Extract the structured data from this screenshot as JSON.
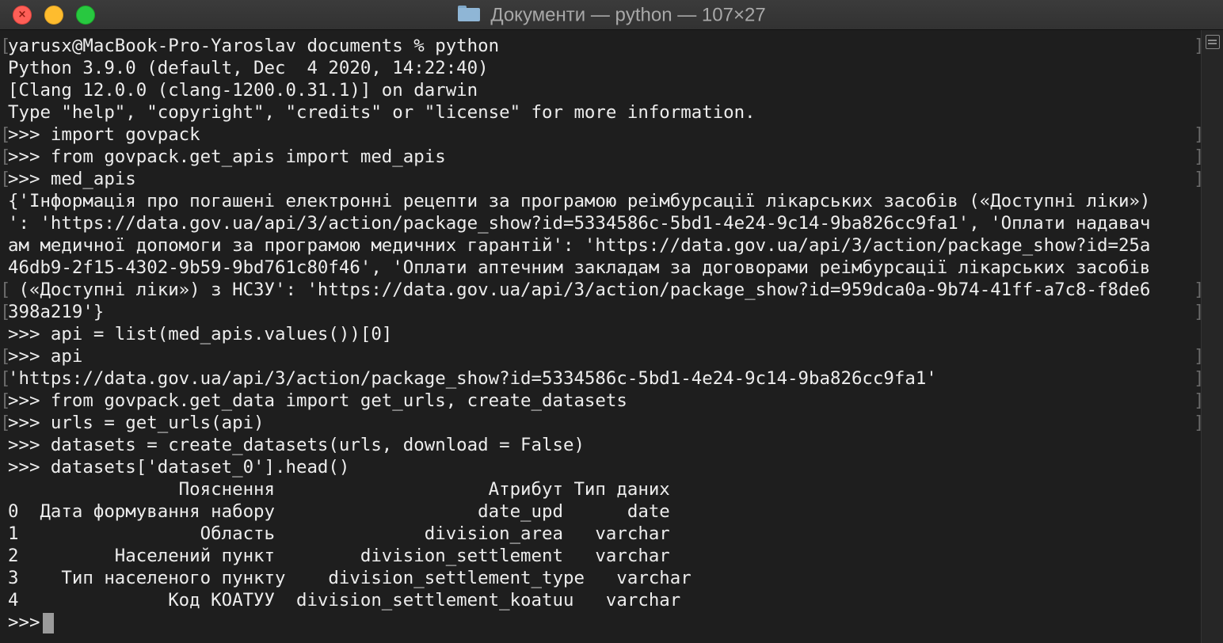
{
  "window": {
    "title": "Документи — python — 107×27",
    "folder_icon": "folder-icon"
  },
  "terminal": {
    "lines": [
      {
        "text": "yarusx@MacBook-Pro-Yaroslav documents % python",
        "marker": "both"
      },
      {
        "text": "Python 3.9.0 (default, Dec  4 2020, 14:22:40)",
        "marker": "none"
      },
      {
        "text": "[Clang 12.0.0 (clang-1200.0.31.1)] on darwin",
        "marker": "none"
      },
      {
        "text": "Type \"help\", \"copyright\", \"credits\" or \"license\" for more information.",
        "marker": "none"
      },
      {
        "text": ">>> import govpack",
        "marker": "both"
      },
      {
        "text": ">>> from govpack.get_apis import med_apis",
        "marker": "both"
      },
      {
        "text": ">>> med_apis",
        "marker": "both"
      },
      {
        "text": "{'Інформація про погашені електронні рецепти за програмою реімбурсації лікарських засобів («Доступні ліки»)",
        "marker": "none"
      },
      {
        "text": "': 'https://data.gov.ua/api/3/action/package_show?id=5334586c-5bd1-4e24-9c14-9ba826cc9fa1', 'Оплати надавач",
        "marker": "none"
      },
      {
        "text": "ам медичної допомоги за програмою медичних гарантій': 'https://data.gov.ua/api/3/action/package_show?id=25a",
        "marker": "none"
      },
      {
        "text": "46db9-2f15-4302-9b59-9bd761c80f46', 'Оплати аптечним закладам за договорами реімбурсації лікарських засобів",
        "marker": "none"
      },
      {
        "text": " («Доступні ліки») з НСЗУ': 'https://data.gov.ua/api/3/action/package_show?id=959dca0a-9b74-41ff-a7c8-f8de6",
        "marker": "both"
      },
      {
        "text": "398a219'}",
        "marker": "both"
      },
      {
        "text": ">>> api = list(med_apis.values())[0]",
        "marker": "none"
      },
      {
        "text": ">>> api",
        "marker": "both"
      },
      {
        "text": "'https://data.gov.ua/api/3/action/package_show?id=5334586c-5bd1-4e24-9c14-9ba826cc9fa1'",
        "marker": "both"
      },
      {
        "text": ">>> from govpack.get_data import get_urls, create_datasets",
        "marker": "both"
      },
      {
        "text": ">>> urls = get_urls(api)",
        "marker": "both"
      },
      {
        "text": ">>> datasets = create_datasets(urls, download = False)",
        "marker": "none"
      },
      {
        "text": ">>> datasets['dataset_0'].head()",
        "marker": "none"
      },
      {
        "text": "                Пояснення                    Атрибут Тип даних",
        "marker": "none"
      },
      {
        "text": "0  Дата формування набору                   date_upd      date",
        "marker": "none"
      },
      {
        "text": "1                 Область              division_area   varchar",
        "marker": "none"
      },
      {
        "text": "2         Населений пункт        division_settlement   varchar",
        "marker": "none"
      },
      {
        "text": "3    Тип населеного пункту    division_settlement_type   varchar",
        "marker": "none"
      },
      {
        "text": "4              Код КОАТУУ  division_settlement_koatuu   varchar",
        "marker": "none"
      },
      {
        "text": ">>>",
        "marker": "none",
        "cursor": true
      }
    ]
  },
  "scrollbar": {
    "grip_icon": "list-icon"
  }
}
